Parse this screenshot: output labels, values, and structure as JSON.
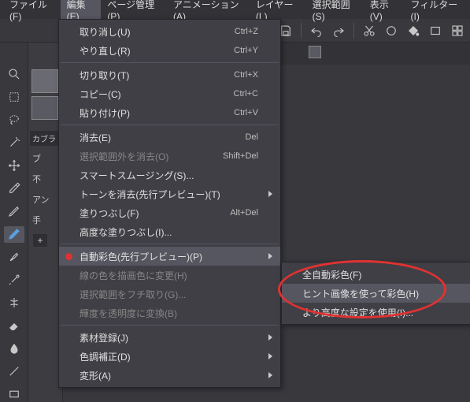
{
  "menubar": {
    "file": "ファイル(F)",
    "edit": "編集(E)",
    "page": "ページ管理(P)",
    "anim": "アニメーション(A)",
    "layer": "レイヤー(L)",
    "select": "選択範囲(S)",
    "view": "表示(V)",
    "filter": "フィルター(I)"
  },
  "sidepanel": {
    "brush_label": "カブラ",
    "r1": "ブ",
    "r2": "不",
    "r3": "アン",
    "r4": "手",
    "plus": "+"
  },
  "edit_menu": [
    {
      "id": "undo",
      "label": "取り消し(U)",
      "shortcut": "Ctrl+Z",
      "enabled": true
    },
    {
      "id": "redo",
      "label": "やり直し(R)",
      "shortcut": "Ctrl+Y",
      "enabled": true
    },
    {
      "sep": true
    },
    {
      "id": "cut",
      "label": "切り取り(T)",
      "shortcut": "Ctrl+X",
      "enabled": true
    },
    {
      "id": "copy",
      "label": "コピー(C)",
      "shortcut": "Ctrl+C",
      "enabled": true
    },
    {
      "id": "paste",
      "label": "貼り付け(P)",
      "shortcut": "Ctrl+V",
      "enabled": true
    },
    {
      "sep": true
    },
    {
      "id": "clear",
      "label": "消去(E)",
      "shortcut": "Del",
      "enabled": true
    },
    {
      "id": "clear-outside",
      "label": "選択範囲外を消去(O)",
      "shortcut": "Shift+Del",
      "enabled": false
    },
    {
      "id": "smart-smooth",
      "label": "スマートスムージング(S)...",
      "enabled": true
    },
    {
      "id": "remove-tone",
      "label": "トーンを消去(先行プレビュー)(T)",
      "enabled": true,
      "submenu": true
    },
    {
      "id": "fill",
      "label": "塗りつぶし(F)",
      "shortcut": "Alt+Del",
      "enabled": true
    },
    {
      "id": "adv-fill",
      "label": "高度な塗りつぶし(I)...",
      "enabled": true
    },
    {
      "sep": true
    },
    {
      "id": "colorize",
      "label": "自動彩色(先行プレビュー)(P)",
      "enabled": true,
      "submenu": true,
      "highlight": true,
      "bullet": true
    },
    {
      "id": "line-to-draw",
      "label": "線の色を描画色に変更(H)",
      "enabled": false
    },
    {
      "id": "sel-border",
      "label": "選択範囲をフチ取り(G)...",
      "enabled": false
    },
    {
      "id": "bright-opac",
      "label": "輝度を透明度に変換(B)",
      "enabled": false
    },
    {
      "sep": true
    },
    {
      "id": "register-mat",
      "label": "素材登録(J)",
      "enabled": true,
      "submenu": true
    },
    {
      "id": "tonal-correct",
      "label": "色調補正(D)",
      "enabled": true,
      "submenu": true
    },
    {
      "id": "transform",
      "label": "変形(A)",
      "enabled": true,
      "submenu": true
    }
  ],
  "colorize_submenu": [
    {
      "id": "full-auto",
      "label": "全自動彩色(F)",
      "enabled": true
    },
    {
      "id": "hint-image",
      "label": "ヒント画像を使って彩色(H)",
      "enabled": true,
      "highlight": true
    },
    {
      "id": "advanced",
      "label": "より高度な設定を使用(I)...",
      "enabled": true
    }
  ]
}
